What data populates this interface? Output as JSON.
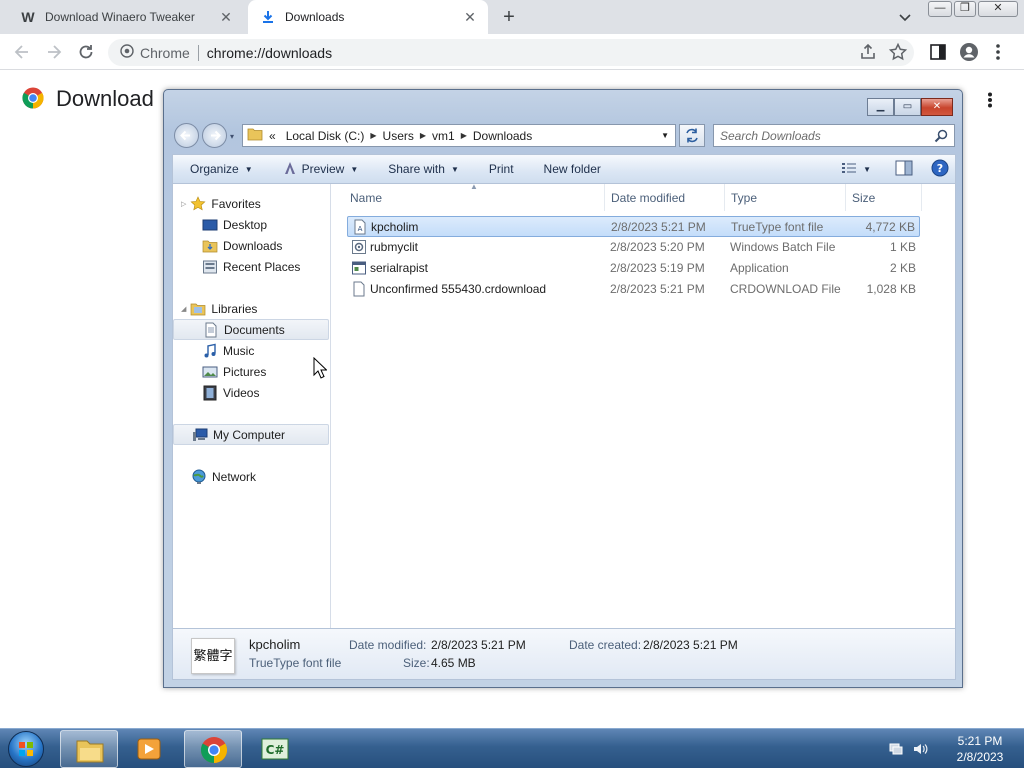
{
  "browser": {
    "tabs": [
      {
        "title": "Download Winaero Tweaker",
        "favicon": "W"
      },
      {
        "title": "Downloads"
      }
    ],
    "omnibox": {
      "site_chip": "Chrome",
      "url": "chrome://downloads"
    },
    "page_title": "Download"
  },
  "explorer": {
    "breadcrumb": [
      "Local Disk (C:)",
      "Users",
      "vm1",
      "Downloads"
    ],
    "search_placeholder": "Search Downloads",
    "commands": {
      "organize": "Organize",
      "preview": "Preview",
      "share_with": "Share with",
      "print": "Print",
      "new_folder": "New folder"
    },
    "nav": {
      "favorites": "Favorites",
      "desktop": "Desktop",
      "downloads": "Downloads",
      "recent_places": "Recent Places",
      "libraries": "Libraries",
      "documents": "Documents",
      "music": "Music",
      "pictures": "Pictures",
      "videos": "Videos",
      "my_computer": "My Computer",
      "network": "Network"
    },
    "columns": {
      "name": "Name",
      "date": "Date modified",
      "type": "Type",
      "size": "Size"
    },
    "files": [
      {
        "name": "kpcholim",
        "date": "2/8/2023 5:21 PM",
        "type": "TrueType font file",
        "size": "4,772 KB"
      },
      {
        "name": "rubmyclit",
        "date": "2/8/2023 5:20 PM",
        "type": "Windows Batch File",
        "size": "1 KB"
      },
      {
        "name": "serialrapist",
        "date": "2/8/2023 5:19 PM",
        "type": "Application",
        "size": "2 KB"
      },
      {
        "name": "Unconfirmed 555430.crdownload",
        "date": "2/8/2023 5:21 PM",
        "type": "CRDOWNLOAD File",
        "size": "1,028 KB"
      }
    ],
    "details": {
      "thumb_text": "繁體字",
      "name": "kpcholim",
      "type": "TrueType font file",
      "date_modified_label": "Date modified:",
      "date_modified": "2/8/2023 5:21 PM",
      "date_created_label": "Date created:",
      "date_created": "2/8/2023 5:21 PM",
      "size_label": "Size:",
      "size": "4.65 MB"
    }
  },
  "taskbar": {
    "time": "5:21 PM",
    "date": "2/8/2023"
  }
}
